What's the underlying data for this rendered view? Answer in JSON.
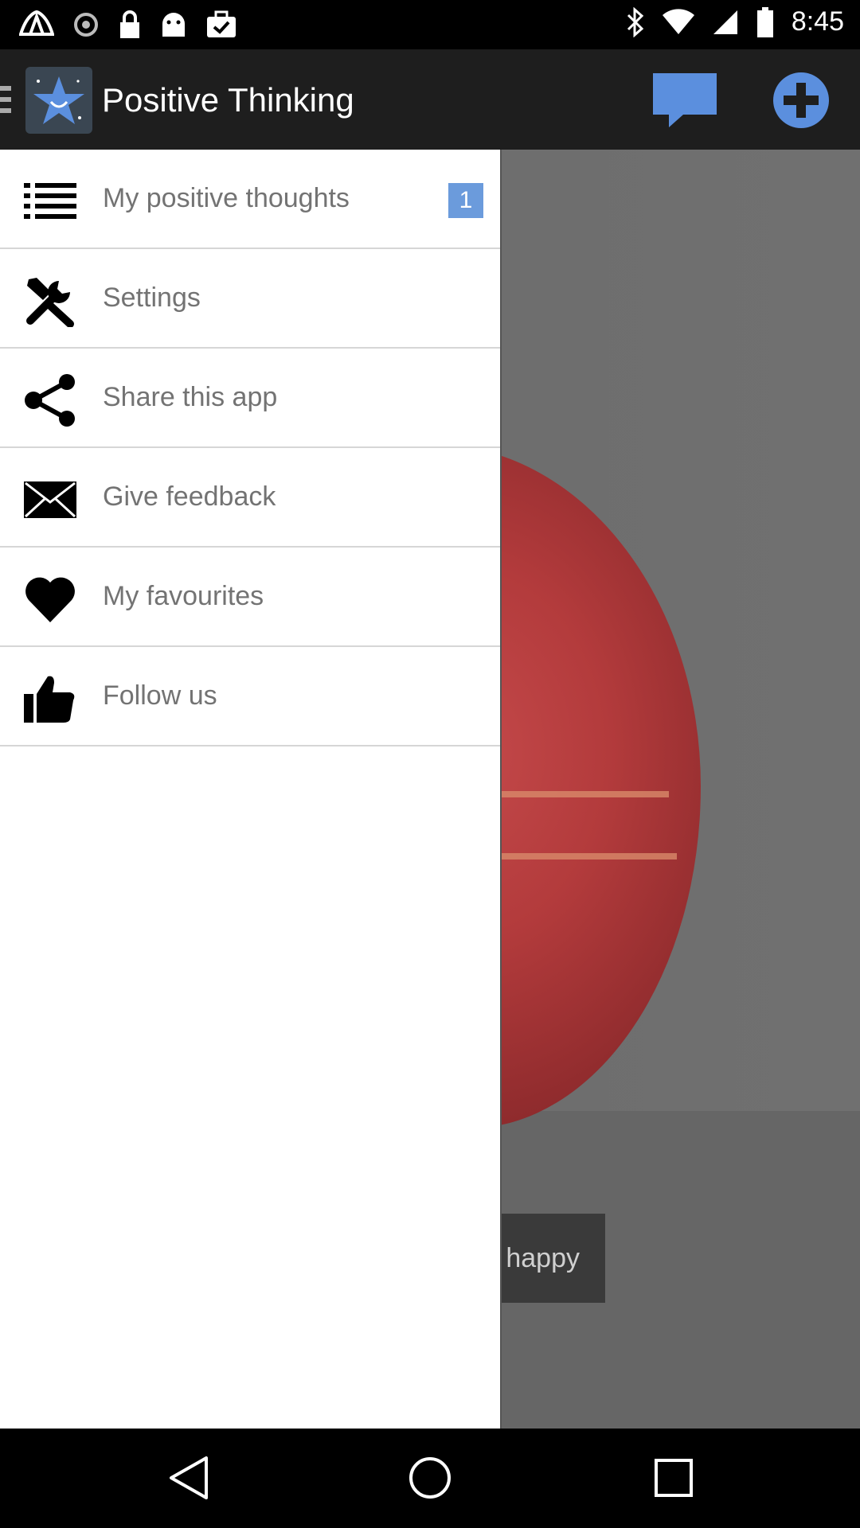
{
  "status_bar": {
    "time": "8:45",
    "icons": [
      "app-notification-icon",
      "sync-icon",
      "lock-icon",
      "android-icon",
      "task-icon",
      "bluetooth-icon",
      "wifi-icon",
      "signal-icon",
      "battery-icon"
    ]
  },
  "toolbar": {
    "title": "Positive Thinking",
    "icons": [
      "menu-icon",
      "star-logo-icon",
      "chat-icon",
      "add-icon"
    ],
    "accent": "#5b8fde"
  },
  "drawer": {
    "items": [
      {
        "label": "My positive thoughts",
        "icon": "list-icon",
        "badge": "1"
      },
      {
        "label": "Settings",
        "icon": "tools-icon"
      },
      {
        "label": "Share this app",
        "icon": "share-icon"
      },
      {
        "label": "Give feedback",
        "icon": "envelope-icon"
      },
      {
        "label": "My favourites",
        "icon": "heart-icon"
      },
      {
        "label": "Follow us",
        "icon": "thumbs-up-icon"
      }
    ]
  },
  "background": {
    "button_label": "happy"
  },
  "nav_bar": {
    "icons": [
      "back-icon",
      "home-icon",
      "recents-icon"
    ]
  }
}
